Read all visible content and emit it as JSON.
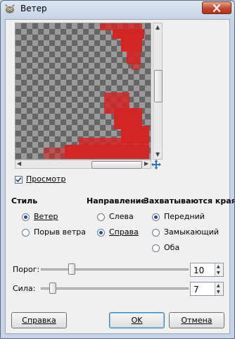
{
  "window": {
    "title": "Ветер"
  },
  "preview": {
    "checkbox_label": "Просмотр",
    "checked": true
  },
  "style_group": {
    "header": "Стиль",
    "options": [
      {
        "label": "Ветер",
        "selected": true
      },
      {
        "label": "Порыв ветра",
        "selected": false
      }
    ]
  },
  "direction_group": {
    "header": "Направление",
    "options": [
      {
        "label": "Слева",
        "selected": false
      },
      {
        "label": "Справа",
        "selected": true
      }
    ]
  },
  "edge_group": {
    "header": "Захватываются края",
    "options": [
      {
        "label": "Передний",
        "selected": true
      },
      {
        "label": "Замыкающий",
        "selected": false
      },
      {
        "label": "Оба",
        "selected": false
      }
    ]
  },
  "threshold": {
    "label": "Порог:",
    "value": "10"
  },
  "strength": {
    "label": "Сила:",
    "value": "7"
  },
  "buttons": {
    "help": "Справка",
    "ok": "OK",
    "cancel": "Отмена"
  },
  "colors": {
    "accent_red": "#d42525",
    "radio_dot": "#1a4fa0"
  },
  "icons": [
    "gimp-icon",
    "close-icon",
    "navigate-icon",
    "checkmark-icon"
  ]
}
